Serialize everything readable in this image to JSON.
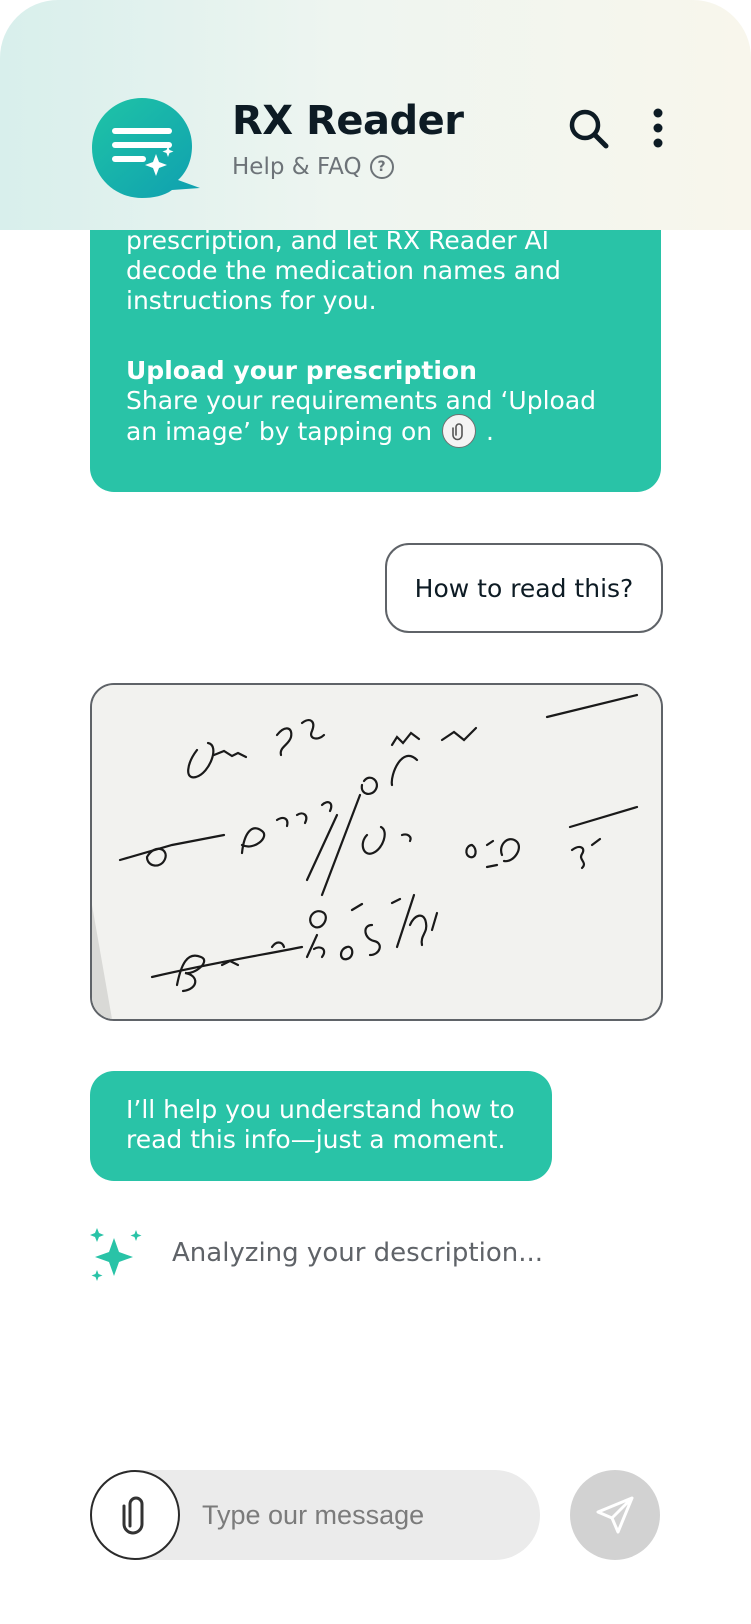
{
  "header": {
    "title": "RX Reader",
    "help_label": "Help & FAQ",
    "help_icon": "question-circle-icon",
    "search_icon": "search-icon",
    "more_icon": "more-vertical-icon",
    "logo_icon": "chat-menu-sparkle-logo"
  },
  "messages": {
    "bot_intro": {
      "text": "prescription, and let RX Reader AI decode the medication names and instructions for you.",
      "upload_title": "Upload your prescription",
      "upload_text_before": "Share your requirements and ‘Upload an image’ by tapping on",
      "upload_text_after": "."
    },
    "user_question": "How to read this?",
    "prescription_image": "handwritten-prescription-photo",
    "bot_reply": "I’ll help you understand how to read this info—just a moment.",
    "status": "Analyzing your description..."
  },
  "composer": {
    "placeholder": "Type our message",
    "attach_icon": "paperclip-icon",
    "send_icon": "send-icon"
  },
  "colors": {
    "accent": "#29c3a7",
    "header_gradient_start": "#d8efec",
    "header_gradient_end": "#f8f6ec",
    "composer_bg": "#ebebeb",
    "send_disabled": "#d2d2d2"
  }
}
